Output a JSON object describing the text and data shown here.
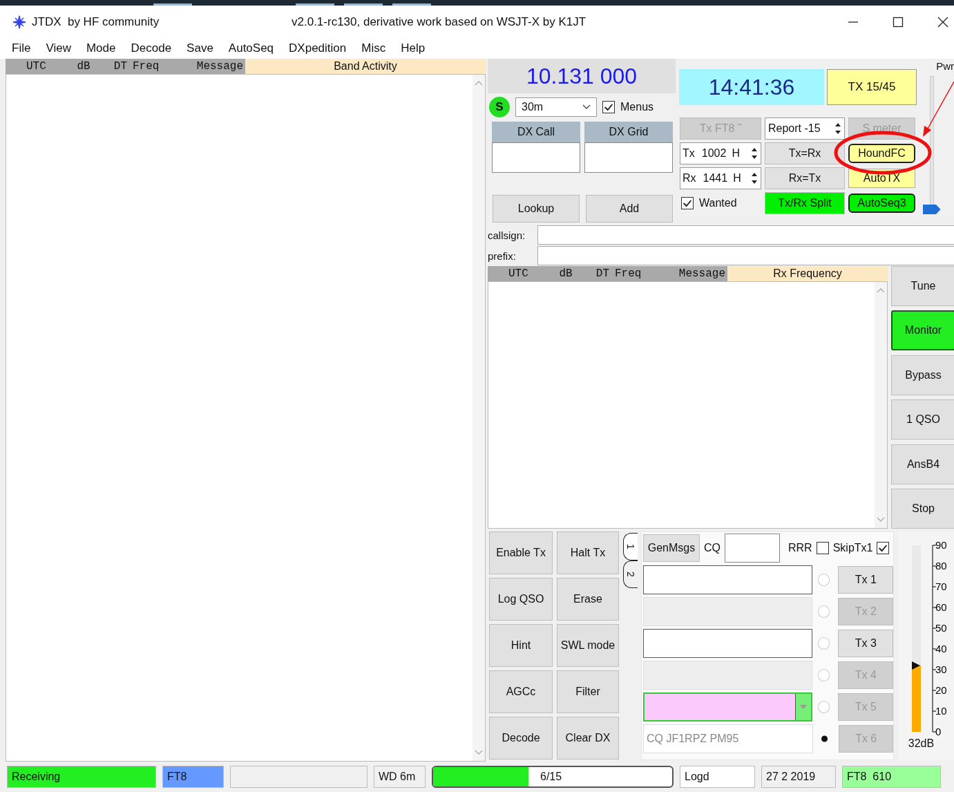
{
  "window": {
    "title": "JTDX  by HF community",
    "subtitle": "v2.0.1-rc130, derivative work based on WSJT-X by K1JT"
  },
  "menu": [
    "File",
    "View",
    "Mode",
    "Decode",
    "Save",
    "AutoSeq",
    "DXpedition",
    "Misc",
    "Help"
  ],
  "band_activity": {
    "columns": [
      "UTC",
      "dB",
      "DT",
      "Freq",
      "Message"
    ],
    "title": "Band Activity"
  },
  "dial": {
    "frequency": "10.131 000",
    "s_label": "S",
    "band": "30m",
    "menus": {
      "label": "Menus",
      "checked": true
    }
  },
  "dx": {
    "call_label": "DX Call",
    "grid_label": "DX Grid",
    "buttons": [
      "Lookup",
      "Add"
    ]
  },
  "clock": "14:41:36",
  "tx_period": "TX 15/45",
  "controls": {
    "mode_button": {
      "label": "Tx FT8 ˜",
      "disabled": true
    },
    "report": {
      "label": "Report",
      "value": "-15"
    },
    "smeter": {
      "label": "S meter",
      "disabled": true
    },
    "spins": [
      {
        "label": "Tx",
        "value": "1002",
        "unit": "H"
      },
      {
        "label": "Rx",
        "value": "1441",
        "unit": "H"
      }
    ],
    "wanted": {
      "label": "Wanted",
      "checked": true
    },
    "middle_buttons": [
      "Tx=Rx",
      "Rx=Tx"
    ],
    "split": {
      "label": "Tx/Rx Split",
      "color": "#00ee00"
    },
    "toggles": [
      {
        "label": "HoundFC",
        "color": "#ffff99"
      },
      {
        "label": "AutoTX",
        "color": "#ffff99"
      },
      {
        "label": "AutoSeq3",
        "color": "#00ee00"
      }
    ]
  },
  "power": {
    "label": "Pwr",
    "level": 0
  },
  "lookup_fields": [
    {
      "label": "callsign:"
    },
    {
      "label": "prefix:"
    }
  ],
  "rx_frequency": {
    "columns": [
      "UTC",
      "dB",
      "DT",
      "Freq",
      "Message"
    ],
    "title": "Rx Frequency"
  },
  "side_buttons": [
    {
      "label": "Tune",
      "on": false
    },
    {
      "label": "Monitor",
      "on": true
    },
    {
      "label": "Bypass",
      "on": false
    },
    {
      "label": "1 QSO",
      "on": false
    },
    {
      "label": "AnsB4",
      "on": false
    },
    {
      "label": "Stop",
      "on": false
    }
  ],
  "action_buttons": [
    "Enable Tx",
    "Halt Tx",
    "Log QSO",
    "Erase",
    "Hint",
    "SWL mode",
    "AGCc",
    "Filter",
    "Decode",
    "Clear DX"
  ],
  "tabs": [
    {
      "label": "1",
      "selected": true
    },
    {
      "label": "2",
      "selected": false
    }
  ],
  "messages": {
    "gen_button": "GenMsgs",
    "cq_label": "CQ",
    "rrr": {
      "label": "RRR",
      "checked": false
    },
    "skip_tx1": {
      "label": "SkipTx1",
      "checked": true
    },
    "rows": [
      {
        "kind": "input",
        "selected": false,
        "button": "Tx 1",
        "disabled": false
      },
      {
        "kind": "disabled",
        "selected": false,
        "button": "Tx 2",
        "disabled": true
      },
      {
        "kind": "input",
        "selected": false,
        "button": "Tx 3",
        "disabled": false
      },
      {
        "kind": "disabled",
        "selected": false,
        "button": "Tx 4",
        "disabled": true
      },
      {
        "kind": "combo",
        "selected": false,
        "button": "Tx 5",
        "disabled": true
      },
      {
        "kind": "readonly",
        "text": "CQ JF1RPZ PM95",
        "selected": true,
        "button": "Tx 6",
        "disabled": true
      }
    ]
  },
  "meter": {
    "ticks": [
      "90",
      "80",
      "70",
      "60",
      "50",
      "40",
      "30",
      "20",
      "10",
      "0"
    ],
    "level": 0.356,
    "reading": "32dB"
  },
  "status_bar": [
    {
      "kind": "label",
      "text": "Receiving",
      "color": "#22ee22"
    },
    {
      "kind": "label",
      "text": "FT8",
      "color": "#6699ff"
    },
    {
      "kind": "blank"
    },
    {
      "kind": "label",
      "text": "WD 6m"
    },
    {
      "kind": "progress",
      "text": "6/15",
      "level": 0.4
    },
    {
      "kind": "label",
      "text": "Logd",
      "color": "#ffffff"
    },
    {
      "kind": "label",
      "text": "27 2 2019"
    },
    {
      "kind": "label",
      "text": "FT8  610",
      "color": "#99ff99"
    }
  ]
}
